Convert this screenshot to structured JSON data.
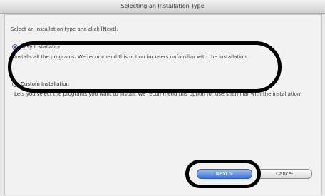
{
  "window": {
    "title": "Selecting an Installation Type"
  },
  "instruction": "Select an installation type and click [Next].",
  "options": [
    {
      "title": "Easy Installation",
      "description": "Installs all the programs. We recommend this option for users unfamiliar with the installation.",
      "selected": true
    },
    {
      "title": "Custom Installation",
      "description": "Lets you select the programs you want to install. We recommend this option for users familiar with the installation.",
      "selected": false
    }
  ],
  "buttons": {
    "next": "Next >",
    "cancel": "Cancel"
  }
}
